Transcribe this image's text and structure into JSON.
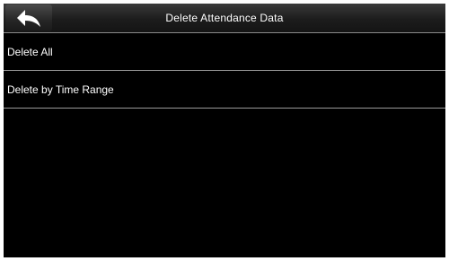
{
  "header": {
    "title": "Delete Attendance Data",
    "back_icon": "back-arrow-icon"
  },
  "menu": {
    "items": [
      {
        "label": "Delete All"
      },
      {
        "label": "Delete by Time Range"
      }
    ]
  },
  "colors": {
    "background": "#000000",
    "text": "#ffffff",
    "divider": "#9a9a9a"
  }
}
